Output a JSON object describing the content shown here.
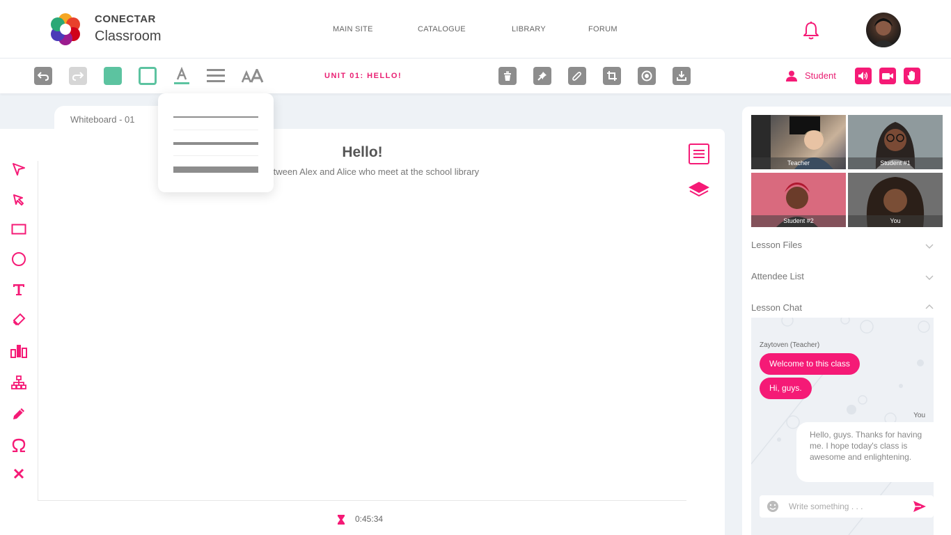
{
  "header": {
    "brand_top": "CONECTAR",
    "brand_bottom": "Classroom",
    "nav": [
      "MAIN SITE",
      "CATALOGUE",
      "LIBRARY",
      "FORUM"
    ]
  },
  "toolbar": {
    "unit_title": "UNIT 01: HELLO!",
    "role_label": "Student"
  },
  "whiteboard": {
    "tab_label": "Whiteboard - 01",
    "title": "Hello!",
    "subtitle": "gue between Alex and Alice who meet at the school library",
    "timer": "0:45:34"
  },
  "videos": [
    {
      "label": "Teacher"
    },
    {
      "label": "Student #1"
    },
    {
      "label": "Student #2"
    },
    {
      "label": "You"
    }
  ],
  "accordion": [
    {
      "label": "Lesson Files",
      "state": "collapsed"
    },
    {
      "label": "Attendee List",
      "state": "collapsed"
    },
    {
      "label": "Lesson Chat",
      "state": "expanded"
    }
  ],
  "chat": {
    "sender": "Zaytoven (Teacher)",
    "messages_in": [
      "Welcome to this class",
      "Hi, guys."
    ],
    "you_label": "You",
    "message_out": "Hello, guys. Thanks for having me. I hope today's class is awesome and enlightening.",
    "input_placeholder": "Write something . . ."
  },
  "colors": {
    "accent": "#f51a76",
    "teal": "#5cc3a0",
    "grey": "#8d8d8d"
  }
}
